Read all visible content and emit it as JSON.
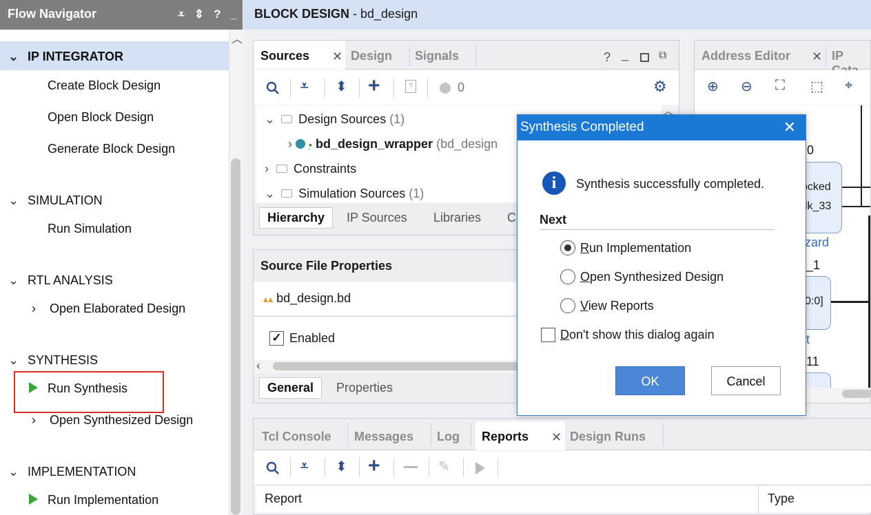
{
  "flow_navigator": {
    "title": "Flow Navigator",
    "sections": [
      {
        "label": "IP INTEGRATOR",
        "items": [
          "Create Block Design",
          "Open Block Design",
          "Generate Block Design"
        ]
      },
      {
        "label": "SIMULATION",
        "items": [
          "Run Simulation"
        ]
      },
      {
        "label": "RTL ANALYSIS",
        "items": [
          "Open Elaborated Design"
        ]
      },
      {
        "label": "SYNTHESIS",
        "items": [
          "Run Synthesis",
          "Open Synthesized Design"
        ]
      },
      {
        "label": "IMPLEMENTATION",
        "items": [
          "Run Implementation"
        ]
      }
    ]
  },
  "header": {
    "title_bold": "BLOCK DESIGN",
    "title_rest": " - bd_design"
  },
  "sources_panel": {
    "tabs": [
      "Sources",
      "Design",
      "Signals"
    ],
    "count": "0",
    "tree": {
      "design_sources": "Design Sources",
      "design_sources_count": "(1)",
      "wrapper": "bd_design_wrapper",
      "wrapper_suffix": "(bd_design",
      "constraints": "Constraints",
      "simulation_sources": "Simulation Sources",
      "simulation_sources_count": "(1)"
    },
    "bottom_tabs": [
      "Hierarchy",
      "IP Sources",
      "Libraries",
      "C"
    ]
  },
  "properties_panel": {
    "title": "Source File Properties",
    "file": "bd_design.bd",
    "enabled_label": "Enabled",
    "bottom_tabs": [
      "General",
      "Properties"
    ]
  },
  "address_panel": {
    "tabs": [
      "Address Editor",
      "IP Cata"
    ],
    "canvas_text": [
      "0",
      "ocked",
      "lk_33",
      "zard",
      "_1",
      "0:0]",
      "t",
      "11"
    ]
  },
  "console_panel": {
    "tabs": [
      "Tcl Console",
      "Messages",
      "Log",
      "Reports",
      "Design Runs"
    ],
    "columns": [
      "Report",
      "Type"
    ]
  },
  "dialog": {
    "title": "Synthesis Completed",
    "message": "Synthesis successfully completed.",
    "next_label": "Next",
    "options": [
      {
        "first": "R",
        "rest": "un Implementation",
        "selected": true
      },
      {
        "first": "O",
        "rest": "pen Synthesized Design",
        "selected": false
      },
      {
        "first": "V",
        "rest": "iew Reports",
        "selected": false
      }
    ],
    "dont_show": {
      "first": "D",
      "rest": "on't show this dialog again"
    },
    "ok": "OK",
    "cancel": "Cancel"
  },
  "colors": {
    "highlight_box": "#d93025",
    "dialog_title": "#1a79d4",
    "ok_button": "#4a86d4",
    "play": "#3aa63a"
  }
}
